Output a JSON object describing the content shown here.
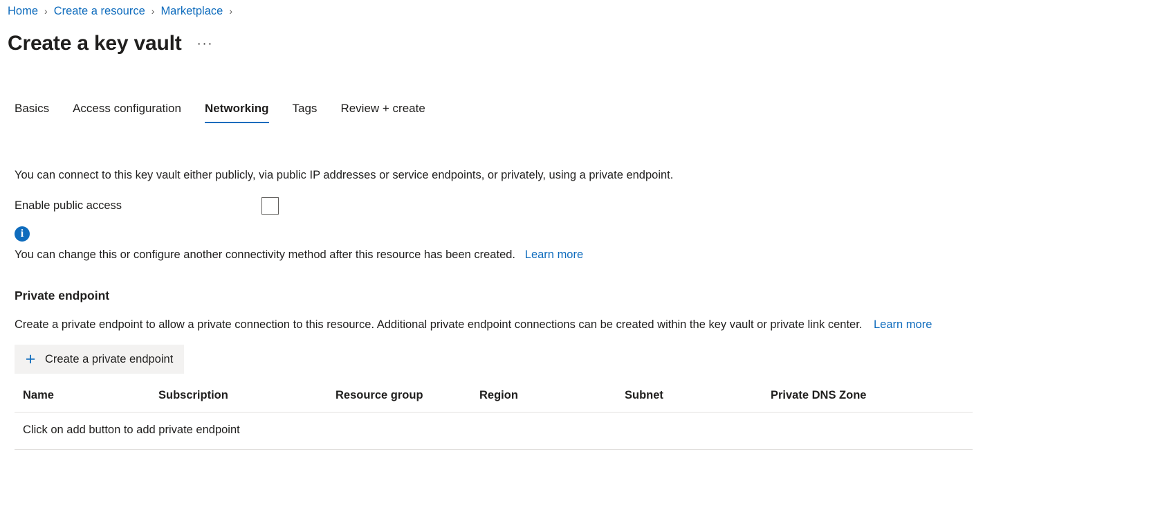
{
  "breadcrumb": {
    "items": [
      {
        "label": "Home"
      },
      {
        "label": "Create a resource"
      },
      {
        "label": "Marketplace"
      }
    ],
    "separator": "›"
  },
  "header": {
    "title": "Create a key vault",
    "more_actions": "···"
  },
  "tabs": [
    {
      "label": "Basics",
      "active": false
    },
    {
      "label": "Access configuration",
      "active": false
    },
    {
      "label": "Networking",
      "active": true
    },
    {
      "label": "Tags",
      "active": false
    },
    {
      "label": "Review + create",
      "active": false
    }
  ],
  "networking": {
    "intro": "You can connect to this key vault either publicly, via public IP addresses or service endpoints, or privately, using a private endpoint.",
    "enable_public_access_label": "Enable public access",
    "enable_public_access_checked": false,
    "info_icon_glyph": "i",
    "info_message": "You can change this or configure another connectivity method after this resource has been created.",
    "info_learn_more": "Learn more"
  },
  "private_endpoint": {
    "heading": "Private endpoint",
    "description": "Create a private endpoint to allow a private connection to this resource. Additional private endpoint connections can be created within the key vault or private link center.",
    "learn_more": "Learn more",
    "create_button": {
      "icon": "+",
      "label": "Create a private endpoint"
    },
    "table": {
      "columns": [
        "Name",
        "Subscription",
        "Resource group",
        "Region",
        "Subnet",
        "Private DNS Zone"
      ],
      "empty_message": "Click on add button to add private endpoint",
      "rows": []
    }
  },
  "colors": {
    "link": "#0f6cbd",
    "accent": "#0f6cbd",
    "text": "#201f1e",
    "button_bg": "#f3f2f1",
    "divider": "#e1dfdd"
  }
}
